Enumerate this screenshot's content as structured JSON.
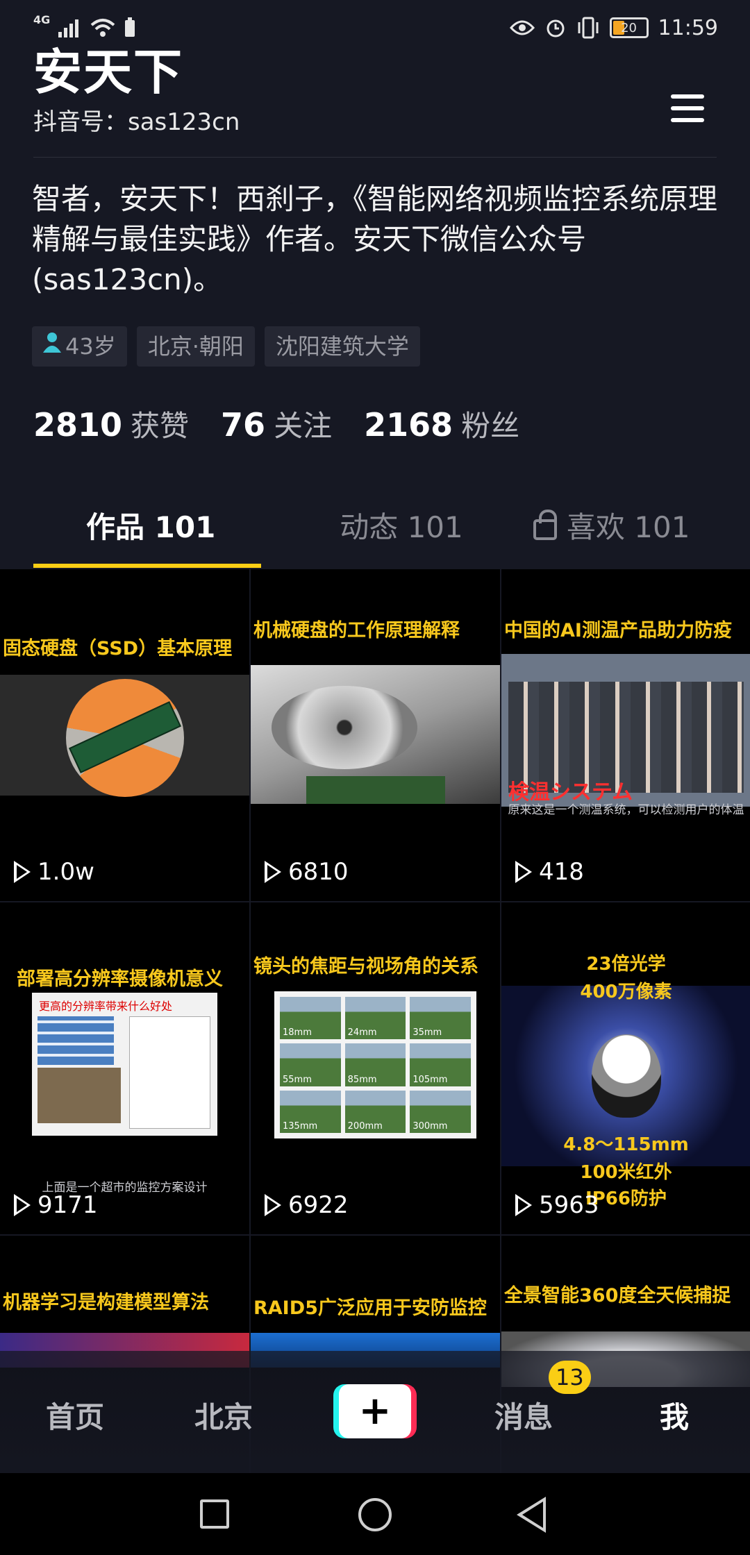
{
  "status_bar": {
    "network": "4G",
    "battery": "20",
    "time": "11:59"
  },
  "profile": {
    "name": "安天下",
    "douyin_id": "抖音号：sas123cn",
    "bio": "智者，安天下！西刹子，《智能网络视频监控系统原理精解与最佳实践》作者。安天下微信公众号(sas123cn)。",
    "tags": [
      "43岁",
      "北京·朝阳",
      "沈阳建筑大学"
    ]
  },
  "stats": [
    {
      "num": "2810",
      "label": "获赞"
    },
    {
      "num": "76",
      "label": "关注"
    },
    {
      "num": "2168",
      "label": "粉丝"
    }
  ],
  "tabs": [
    {
      "label": "作品 101"
    },
    {
      "label": "动态 101"
    },
    {
      "label": "喜欢 101"
    }
  ],
  "videos": [
    {
      "caption": "固态硬盘（SSD）基本原理",
      "plays": "1.0w"
    },
    {
      "caption": "机械硬盘的工作原理解释",
      "plays": "6810"
    },
    {
      "caption": "中国的AI测温产品助力防疫",
      "plays": "418",
      "overlay": "検温システム",
      "sub": "原来这是一个测温系统，可以检测用户的体温"
    },
    {
      "caption": "部署高分辨率摄像机意义",
      "plays": "9171",
      "doc_head": "更高的分辨率带来什么好处",
      "sub": "上面是一个超市的监控方案设计"
    },
    {
      "caption": "镜头的焦距与视场角的关系",
      "plays": "6922",
      "focals": [
        "18mm",
        "24mm",
        "35mm",
        "55mm",
        "85mm",
        "105mm",
        "135mm",
        "200mm",
        "300mm"
      ]
    },
    {
      "caption": "",
      "plays": "5963",
      "lines_top": [
        "23倍光学",
        "400万像素"
      ],
      "lines_bottom": [
        "4.8～115mm",
        "100米红外",
        "IP66防护"
      ]
    },
    {
      "caption": "机器学习是构建模型算法",
      "plays": ""
    },
    {
      "caption": "RAID5广泛应用于安防监控",
      "plays": ""
    },
    {
      "caption": "全景智能360度全天候捕捉",
      "plays": ""
    }
  ],
  "bottom_nav": {
    "home": "首页",
    "city": "北京",
    "plus": "+",
    "messages": "消息",
    "messages_badge": "13",
    "me": "我"
  },
  "colors": {
    "background": "#161823",
    "accent": "#face15",
    "caption": "#f8c81d"
  }
}
